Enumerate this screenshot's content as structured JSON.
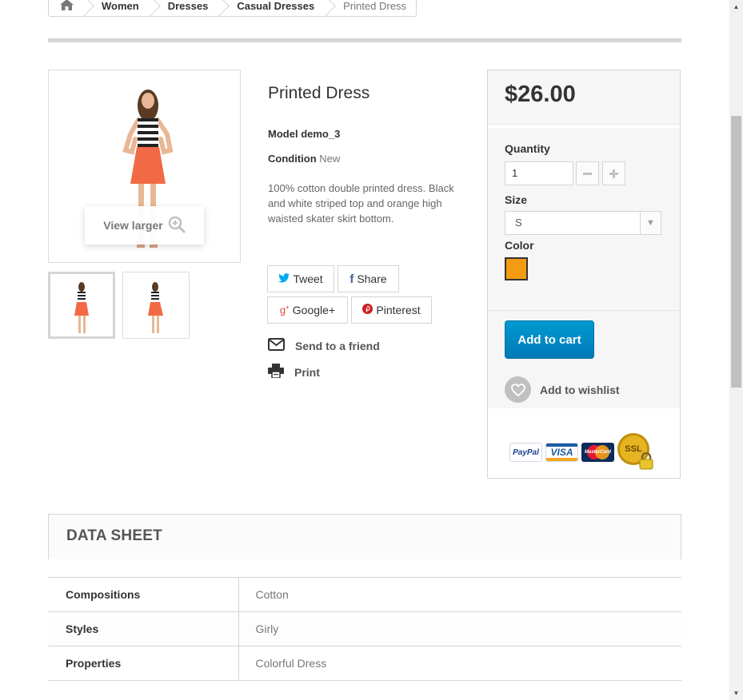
{
  "breadcrumb": {
    "home_icon": "home-icon",
    "items": [
      "Women",
      "Dresses",
      "Casual Dresses"
    ],
    "current": "Printed Dress"
  },
  "gallery": {
    "view_larger": "View larger",
    "zoom_icon": "zoom-in-icon"
  },
  "product": {
    "name": "Printed Dress",
    "model_label": "Model",
    "model_value": "demo_3",
    "condition_label": "Condition",
    "condition_value": "New",
    "description": "100% cotton double printed dress. Black and white striped top and orange high waisted skater skirt bottom."
  },
  "social": {
    "tweet": "Tweet",
    "share": "Share",
    "google": "Google+",
    "pinterest": "Pinterest"
  },
  "actions": {
    "send_friend": "Send to a friend",
    "print": "Print"
  },
  "buy_box": {
    "price": "$26.00",
    "quantity_label": "Quantity",
    "quantity_value": "1",
    "size_label": "Size",
    "size_value": "S",
    "color_label": "Color",
    "color_value": "#f39c11",
    "add_to_cart": "Add to cart",
    "add_to_wishlist": "Add to wishlist",
    "payment_logos": [
      "PayPal",
      "VISA",
      "MasterCard",
      "SSL"
    ]
  },
  "datasheet": {
    "title": "DATA SHEET",
    "rows": [
      {
        "key": "Compositions",
        "value": "Cotton"
      },
      {
        "key": "Styles",
        "value": "Girly"
      },
      {
        "key": "Properties",
        "value": "Colorful Dress"
      }
    ]
  },
  "colors": {
    "accent": "#007ab7",
    "swatch_orange": "#f39c11"
  }
}
